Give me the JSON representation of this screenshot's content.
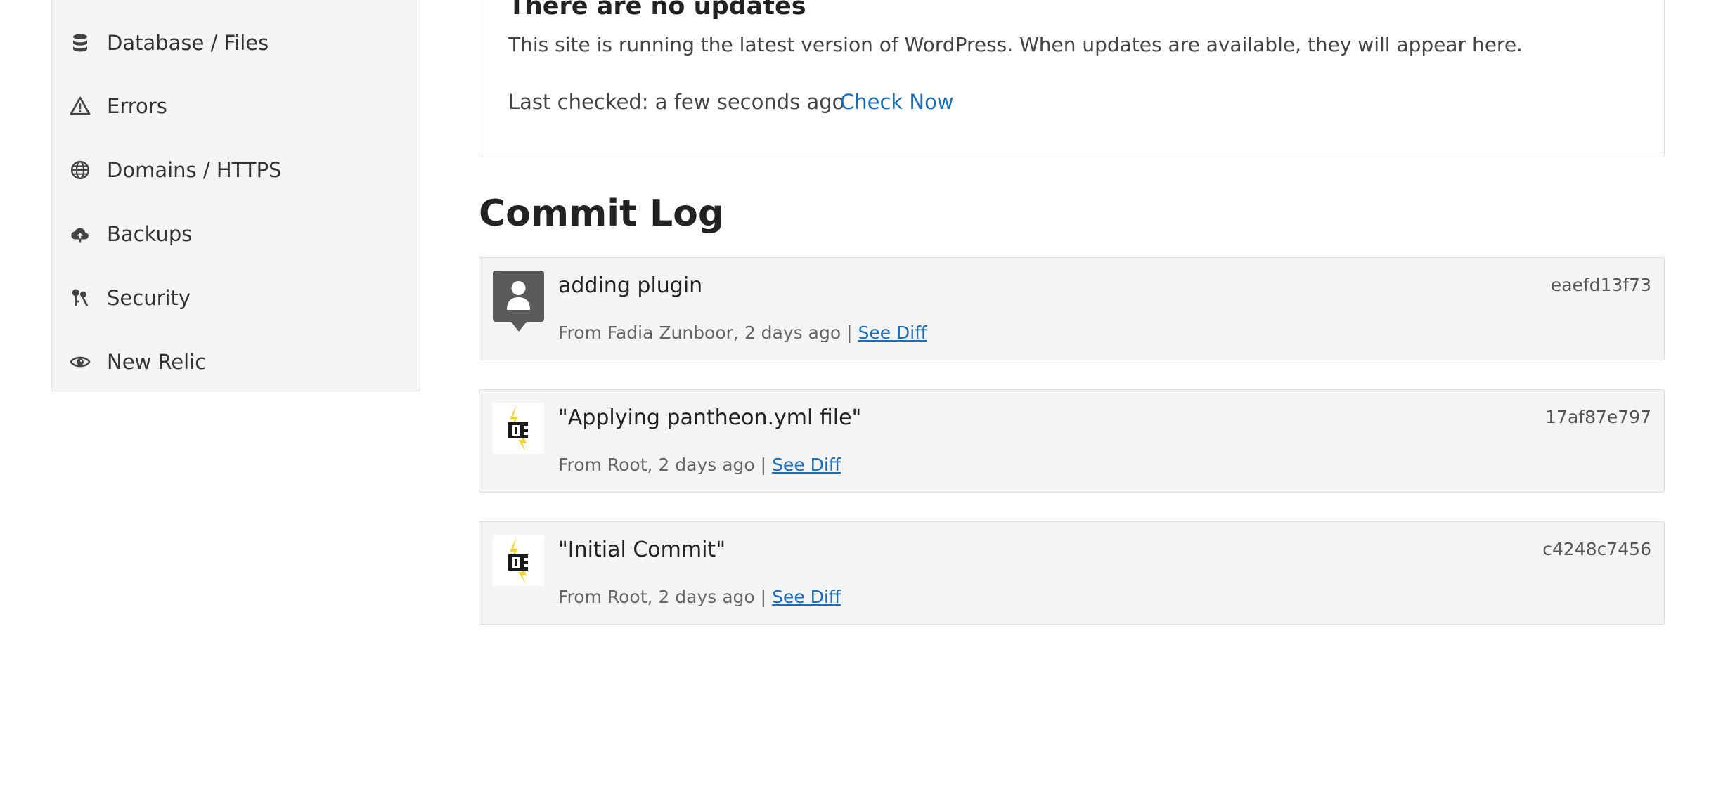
{
  "sidebar": {
    "items": [
      {
        "label": "Database / Files",
        "icon": "database-icon"
      },
      {
        "label": "Errors",
        "icon": "warning-icon"
      },
      {
        "label": "Domains / HTTPS",
        "icon": "globe-icon"
      },
      {
        "label": "Backups",
        "icon": "cloud-upload-icon"
      },
      {
        "label": "Security",
        "icon": "keys-icon"
      },
      {
        "label": "New Relic",
        "icon": "eye-icon"
      }
    ]
  },
  "updates": {
    "title": "There are no updates",
    "description": "This site is running the latest version of WordPress. When updates are available, they will appear here.",
    "last_checked": "Last checked: a few seconds ago",
    "check_now": "Check Now"
  },
  "commit_log": {
    "heading": "Commit Log",
    "separator": "|",
    "see_diff": "See Diff",
    "commits": [
      {
        "message": "adding plugin",
        "hash": "eaefd13f73",
        "meta": "From Fadia Zunboor, 2 days ago",
        "avatar": "person-avatar-icon"
      },
      {
        "message": "\"Applying pantheon.yml file\"",
        "hash": "17af87e797",
        "meta": "From Root, 2 days ago",
        "avatar": "pantheon-logo-icon"
      },
      {
        "message": "\"Initial Commit\"",
        "hash": "c4248c7456",
        "meta": "From Root, 2 days ago",
        "avatar": "pantheon-logo-icon"
      }
    ]
  }
}
